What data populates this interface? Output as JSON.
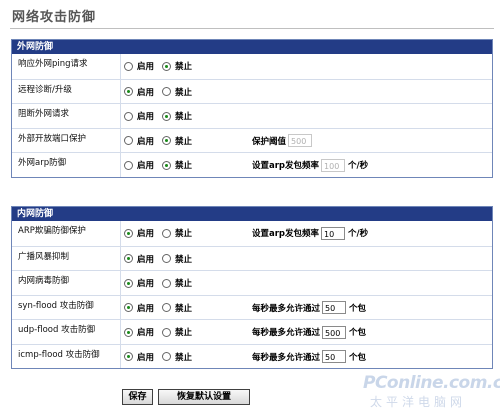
{
  "page": {
    "title": "网络攻击防御"
  },
  "external": {
    "header": "外网防御",
    "rows": [
      {
        "label": "响应外网ping请求",
        "enable": "启用",
        "disable": "禁止",
        "selected": "disable"
      },
      {
        "label": "远程诊断/升级",
        "enable": "启用",
        "disable": "禁止",
        "selected": "enable"
      },
      {
        "label": "阻断外网请求",
        "enable": "启用",
        "disable": "禁止",
        "selected": "disable"
      },
      {
        "label": "外部开放端口保护",
        "enable": "启用",
        "disable": "禁止",
        "selected": "disable",
        "extra_label": "保护阈值",
        "value": "500",
        "disabled": true
      },
      {
        "label": "外网arp防御",
        "enable": "启用",
        "disable": "禁止",
        "selected": "disable",
        "extra_label": "设置arp发包频率",
        "value": "100",
        "unit": "个/秒",
        "disabled": true
      }
    ]
  },
  "internal": {
    "header": "内网防御",
    "rows": [
      {
        "label": "ARP欺骗防御保护",
        "enable": "启用",
        "disable": "禁止",
        "selected": "enable",
        "extra_label": "设置arp发包频率",
        "value": "10",
        "unit": "个/秒"
      },
      {
        "label": "广播风暴抑制",
        "enable": "启用",
        "disable": "禁止",
        "selected": "enable"
      },
      {
        "label": "内网病毒防御",
        "enable": "启用",
        "disable": "禁止",
        "selected": "enable"
      },
      {
        "label": "syn-flood 攻击防御",
        "enable": "启用",
        "disable": "禁止",
        "selected": "enable",
        "extra_label": "每秒最多允许通过",
        "value": "50",
        "unit": "个包"
      },
      {
        "label": "udp-flood 攻击防御",
        "enable": "启用",
        "disable": "禁止",
        "selected": "enable",
        "extra_label": "每秒最多允许通过",
        "value": "500",
        "unit": "个包"
      },
      {
        "label": "icmp-flood 攻击防御",
        "enable": "启用",
        "disable": "禁止",
        "selected": "enable",
        "extra_label": "每秒最多允许通过",
        "value": "50",
        "unit": "个包"
      }
    ]
  },
  "buttons": {
    "save": "保存",
    "restore": "恢复默认设置"
  },
  "watermark": {
    "brand": "PConline.com.cn",
    "subtitle": "太平洋电脑网"
  }
}
